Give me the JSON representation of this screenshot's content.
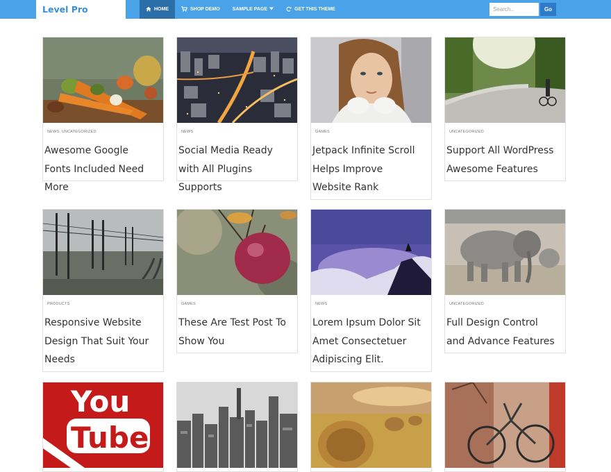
{
  "header": {
    "logo": "Level Pro",
    "nav": [
      {
        "label": "HOME",
        "icon": "home-icon"
      },
      {
        "label": "SHOP DEMO",
        "icon": "cart-icon"
      },
      {
        "label": "SAMPLE PAGE",
        "icon": "chevron-down-icon"
      },
      {
        "label": "GET THIS THEME",
        "icon": "refresh-icon"
      }
    ],
    "search_placeholder": "Search..",
    "search_button": "Go"
  },
  "posts": [
    {
      "category": "NEWS, UNCATEGORIZED",
      "title": "Awesome Google Fonts Included Need More",
      "image": "vegetables"
    },
    {
      "category": "NEWS",
      "title": "Social Media Ready with All Plugins Supports",
      "image": "city-night"
    },
    {
      "category": "GAMES",
      "title": "Jetpack Infinite Scroll Helps Improve Website Rank",
      "image": "woman-portrait"
    },
    {
      "category": "UNCATEGORIZED",
      "title": "Support All WordPress Awesome Features",
      "image": "park-cyclist"
    },
    {
      "category": "PRODUCTS",
      "title": "Responsive Website Design That Suit Your Needs",
      "image": "railway"
    },
    {
      "category": "GAMES",
      "title": "These Are Test Post To Show You",
      "image": "apple"
    },
    {
      "category": "NEWS",
      "title": "Lorem Ipsum Dolor Sit Amet Consectetuer Adipiscing Elit.",
      "image": "mountain-dusk"
    },
    {
      "category": "UNCATEGORIZED",
      "title": "Full Design Control and Advance Features",
      "image": "elephants"
    },
    {
      "category": "",
      "title": "",
      "image": "youtube-logo",
      "logo_text": [
        "You",
        "Tube"
      ]
    },
    {
      "category": "",
      "title": "",
      "image": "skyline"
    },
    {
      "category": "",
      "title": "",
      "image": "hay-bales"
    },
    {
      "category": "",
      "title": "",
      "image": "bicycle"
    }
  ]
}
